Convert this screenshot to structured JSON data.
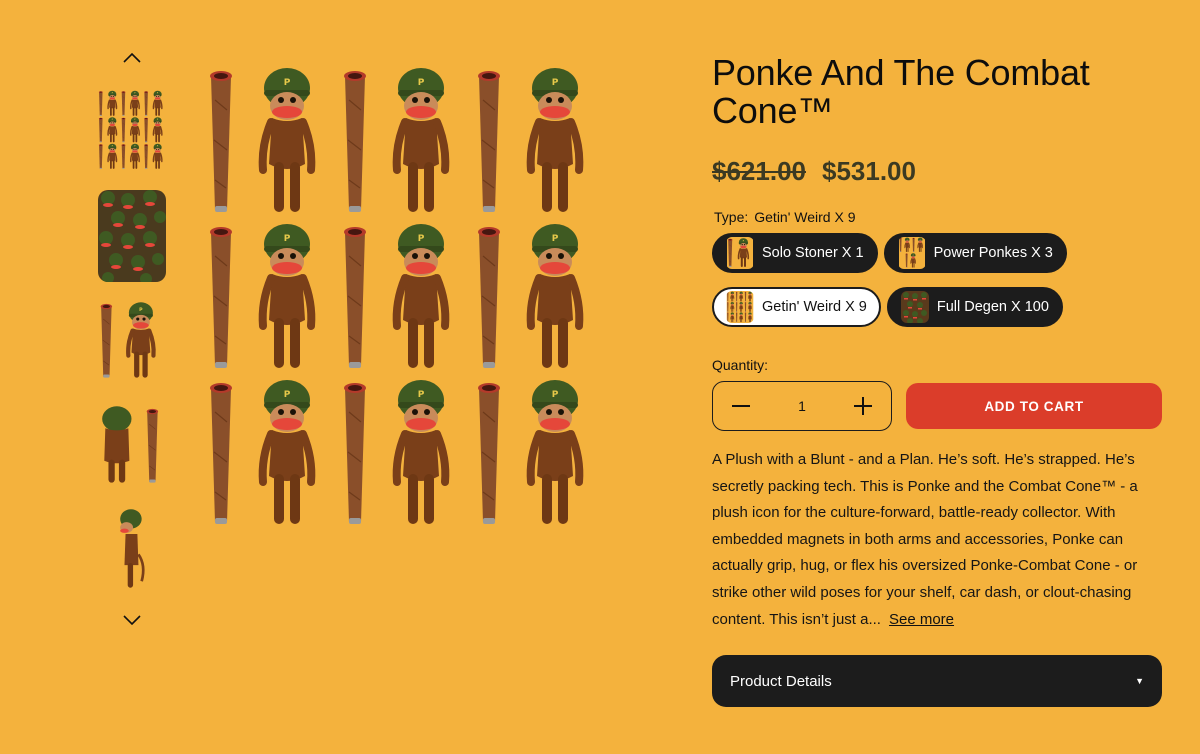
{
  "product": {
    "title": "Ponke And The Combat Cone™",
    "price_original": "$621.00",
    "price_sale": "$531.00"
  },
  "options": {
    "type_label": "Type:",
    "type_selected": "Getin' Weird X 9",
    "variants": [
      {
        "label": "Solo Stoner X 1",
        "selected": false
      },
      {
        "label": "Power Ponkes X 3",
        "selected": false
      },
      {
        "label": "Getin' Weird X 9",
        "selected": true
      },
      {
        "label": "Full Degen X 100",
        "selected": false
      }
    ]
  },
  "quantity": {
    "label": "Quantity:",
    "value": "1"
  },
  "cart": {
    "add_label": "ADD TO CART"
  },
  "description": {
    "text": "A Plush with a Blunt - and a Plan. He’s soft. He’s strapped. He’s secretly packing tech. This is Ponke and the Combat Cone™ - a plush icon for the culture-forward, battle-ready collector. With embedded magnets in both arms and accessories, Ponke can actually grip, hug, or flex his oversized Ponke-Combat Cone - or strike other wild poses for your shelf, car dash, or clout-chasing content. This isn’t just a...",
    "see_more": "See more"
  },
  "accordion": {
    "product_details": "Product Details"
  },
  "colors": {
    "background": "#f4b23d",
    "dark": "#1c1c1c",
    "cta": "#db3d2a",
    "price": "#3c3a22"
  },
  "icons": {
    "up": "chevron-up-icon",
    "down": "chevron-down-icon",
    "minus": "minus-icon",
    "plus": "plus-icon",
    "caret": "caret-down-icon"
  }
}
